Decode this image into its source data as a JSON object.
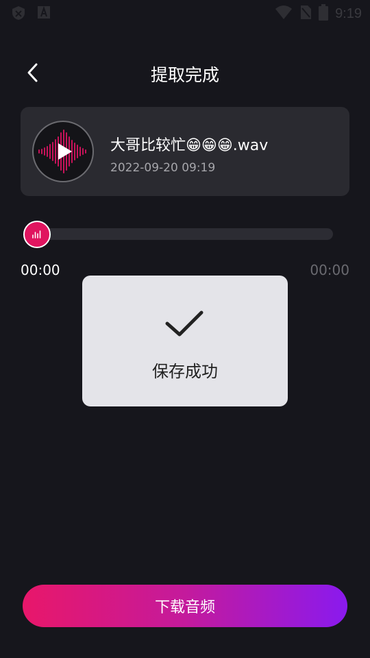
{
  "status_bar": {
    "time": "9:19"
  },
  "header": {
    "title": "提取完成"
  },
  "file": {
    "name": "大哥比较忙😁😁😁.wav",
    "date": "2022-09-20 09:19"
  },
  "player": {
    "current_time": "00:00",
    "total_time": "00:00",
    "progress": 0
  },
  "toast": {
    "message": "保存成功"
  },
  "actions": {
    "download_label": "下载音频"
  },
  "colors": {
    "background": "#16161c",
    "accent": "#e0145f",
    "gradient_start": "#e8176a",
    "gradient_end": "#8a1aee"
  }
}
